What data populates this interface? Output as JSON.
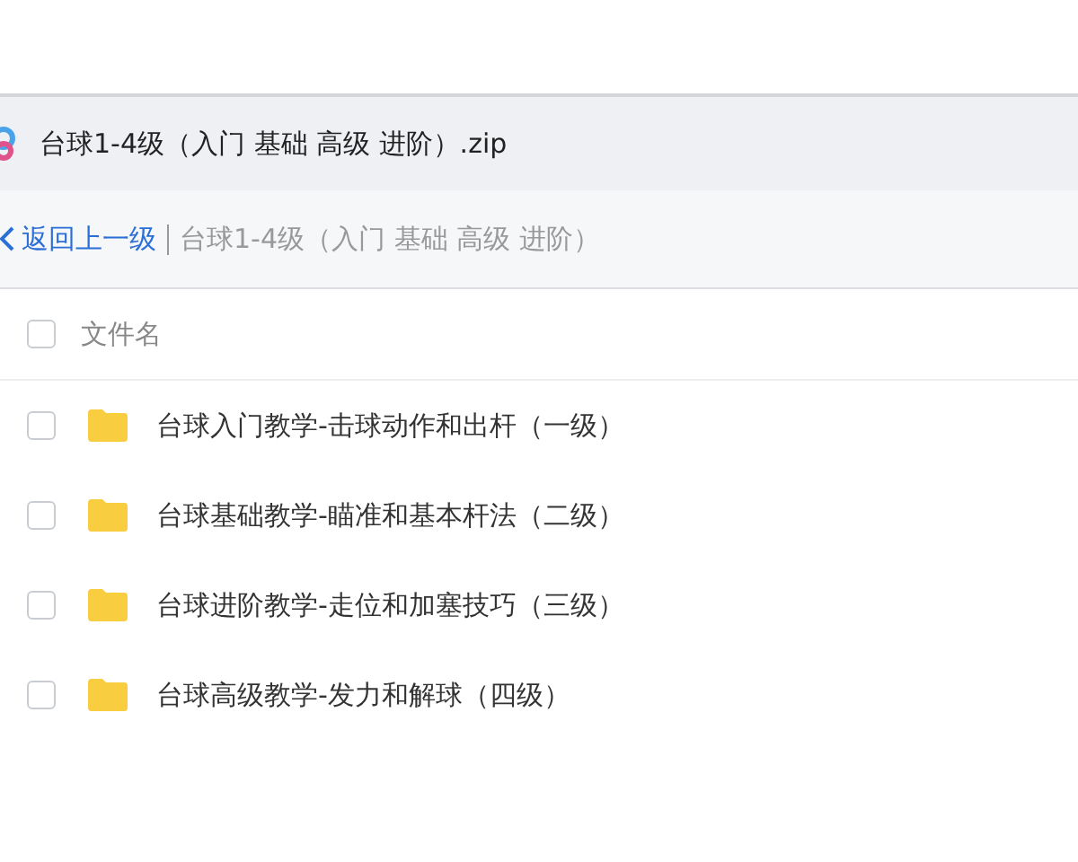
{
  "archive": {
    "title": "台球1-4级（入门 基础 高级 进阶）.zip"
  },
  "breadcrumb": {
    "back": "返回上一级",
    "current": "台球1-4级（入门 基础 高级 进阶）"
  },
  "table": {
    "header": {
      "label": "文件名",
      "checked": false
    },
    "rows": [
      {
        "name": "台球入门教学-击球动作和出杆（一级）",
        "kind": "folder",
        "checked": false
      },
      {
        "name": "台球基础教学-瞄准和基本杆法（二级）",
        "kind": "folder",
        "checked": false
      },
      {
        "name": "台球进阶教学-走位和加塞技巧（三级）",
        "kind": "folder",
        "checked": false
      },
      {
        "name": "台球高级教学-发力和解球（四级）",
        "kind": "folder",
        "checked": false
      }
    ]
  }
}
